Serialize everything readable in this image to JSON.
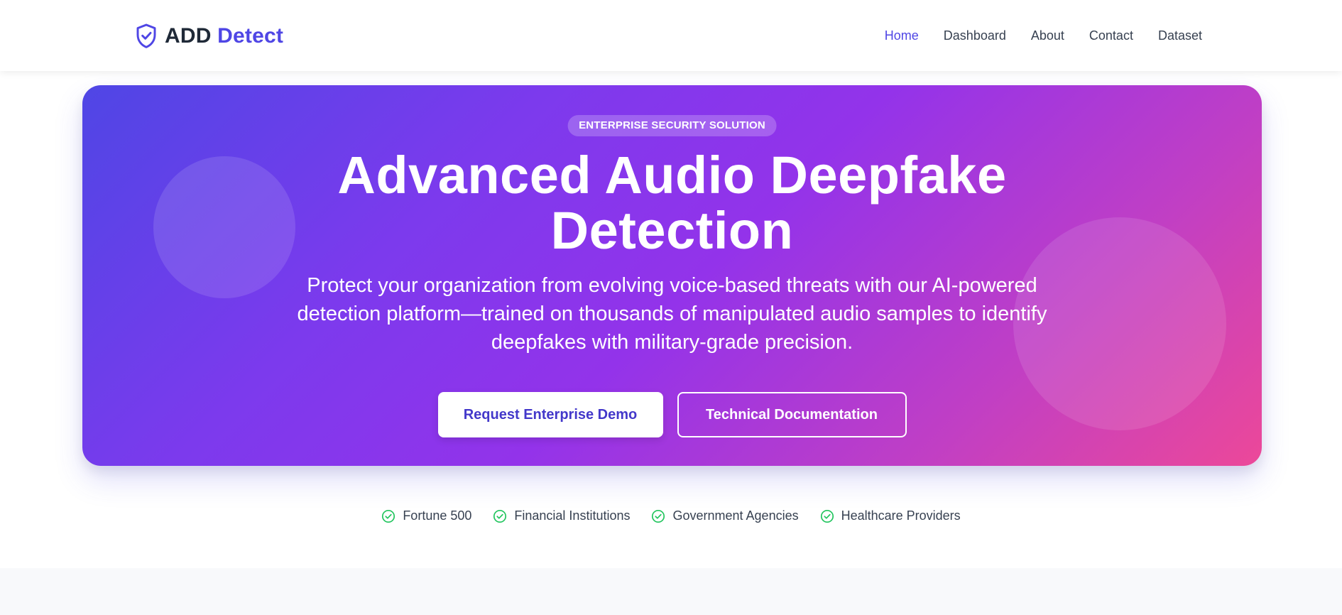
{
  "brand": {
    "name_part1": "ADD",
    "name_part2": "Detect",
    "icon": "shield-check-icon",
    "accent_color": "#4f46e5"
  },
  "nav": {
    "items": [
      {
        "label": "Home",
        "active": true
      },
      {
        "label": "Dashboard",
        "active": false
      },
      {
        "label": "About",
        "active": false
      },
      {
        "label": "Contact",
        "active": false
      },
      {
        "label": "Dataset",
        "active": false
      }
    ]
  },
  "hero": {
    "badge": "ENTERPRISE SECURITY SOLUTION",
    "title_line1": "Advanced Audio Deepfake",
    "title_line2": "Detection",
    "subtitle": "Protect your organization from evolving voice-based threats with our AI-powered detection platform—trained on thousands of manipulated audio samples to identify deepfakes with military-grade precision.",
    "primary_button": "Request Enterprise Demo",
    "secondary_button": "Technical Documentation",
    "gradient_colors": [
      "#4f46e5",
      "#9333ea",
      "#ec4899"
    ]
  },
  "trust": {
    "icon": "check-circle-icon",
    "icon_color": "#22c55e",
    "items": [
      "Fortune 500",
      "Financial Institutions",
      "Government Agencies",
      "Healthcare Providers"
    ]
  }
}
